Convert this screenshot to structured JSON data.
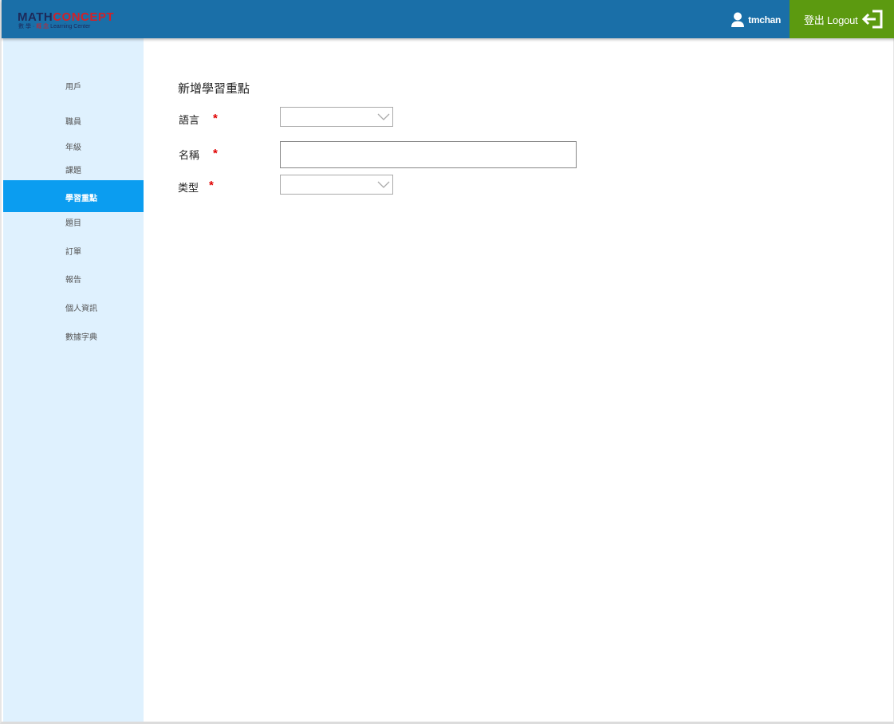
{
  "header": {
    "logo_math": "MATH",
    "logo_concept": "CONCEPT",
    "logo_sub_prefix": "數 學 ·",
    "logo_sub_accent": "概 念",
    "logo_sub_suffix": "Learning Center",
    "username": "tmchan",
    "logout_label": "登出 Logout",
    "colors": {
      "header_bg": "#1a6fa8",
      "logout_bg": "#5c9a10"
    }
  },
  "sidebar": {
    "items": [
      {
        "label": "用戶",
        "icon": "none"
      },
      {
        "label": "職員",
        "icon": "none"
      },
      {
        "label": "年級",
        "icon": "none"
      },
      {
        "label": "課題",
        "icon": "none"
      },
      {
        "label": "學習重點",
        "icon": "none",
        "active": true
      },
      {
        "label": "題目",
        "icon": "none"
      },
      {
        "label": "訂單",
        "icon": "none"
      },
      {
        "label": "報告",
        "icon": "none"
      },
      {
        "label": "個人資訊",
        "icon": "none"
      },
      {
        "label": "數據字典",
        "icon": "none"
      }
    ],
    "colors": {
      "bg": "#dff1fe",
      "active_bg": "#0b9df0"
    }
  },
  "form": {
    "title": "新增學習重點",
    "required_mark": "*",
    "fields": {
      "language": {
        "label": "語言",
        "value": ""
      },
      "name": {
        "label": "名稱",
        "value": ""
      },
      "type": {
        "label": "类型",
        "value": ""
      }
    }
  },
  "icons": {
    "user": "user-icon",
    "logout": "logout-arrow-icon",
    "dropdown": "chevron-down-icon"
  }
}
